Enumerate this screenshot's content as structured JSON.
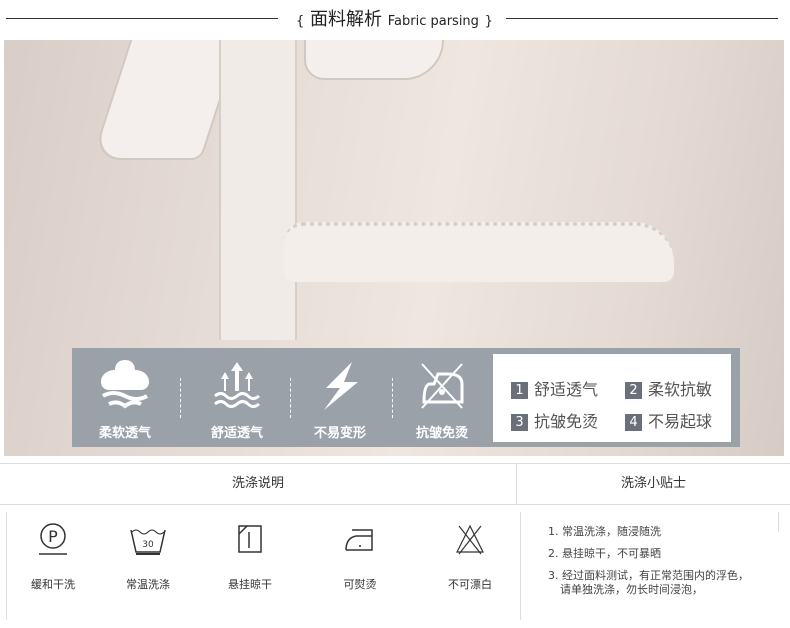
{
  "header": {
    "brace_open": "{",
    "title_cn": "面料解析",
    "title_en": "Fabric parsing",
    "brace_close": "}"
  },
  "features": [
    {
      "icon": "cotton-icon",
      "label": "柔软透气"
    },
    {
      "icon": "breathable-arrows-icon",
      "label": "舒适透气"
    },
    {
      "icon": "lightning-icon",
      "label": "不易变形"
    },
    {
      "icon": "no-iron-icon",
      "label": "抗皱免烫"
    }
  ],
  "benefits": [
    {
      "num": "1",
      "text": "舒适透气"
    },
    {
      "num": "2",
      "text": "柔软抗敏"
    },
    {
      "num": "3",
      "text": "抗皱免烫"
    },
    {
      "num": "4",
      "text": "不易起球"
    }
  ],
  "table": {
    "wash_header": "洗涤说明",
    "tips_header": "洗涤小贴士"
  },
  "care": [
    {
      "icon": "dry-clean-p-icon",
      "label": "缓和干洗"
    },
    {
      "icon": "wash-30-icon",
      "label": "常温洗涤",
      "temp": "30"
    },
    {
      "icon": "hang-dry-icon",
      "label": "悬挂晾干"
    },
    {
      "icon": "iron-icon",
      "label": "可熨烫"
    },
    {
      "icon": "no-bleach-icon",
      "label": "不可漂白"
    }
  ],
  "tips": [
    "1. 常温洗涤，随浸随洗",
    "2. 悬挂晾干，不可暴晒",
    "3. 经过面料测试，有正常范围内的浮色，",
    "请单独洗涤，勿长时间浸泡，"
  ]
}
